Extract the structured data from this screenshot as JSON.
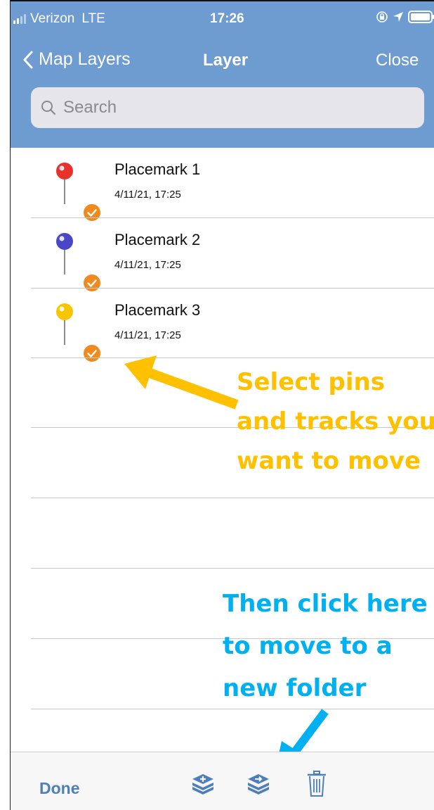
{
  "status_bar": {
    "carrier": "Verizon",
    "network": "LTE",
    "time": "17:26"
  },
  "nav": {
    "back_label": "Map Layers",
    "title": "Layer",
    "close_label": "Close"
  },
  "search": {
    "placeholder": "Search"
  },
  "placemarks": [
    {
      "title": "Placemark 1",
      "timestamp": "4/11/21, 17:25",
      "pin_color": "#e8312a",
      "selected": true
    },
    {
      "title": "Placemark 2",
      "timestamp": "4/11/21, 17:25",
      "pin_color": "#4a46c8",
      "selected": true
    },
    {
      "title": "Placemark 3",
      "timestamp": "4/11/21, 17:25",
      "pin_color": "#f7c600",
      "selected": true
    }
  ],
  "annotations": {
    "select": [
      "Select pins",
      "and tracks you",
      "want to move"
    ],
    "move": [
      "Then click here",
      "to move to a",
      "new folder"
    ],
    "select_color": "#ffc000",
    "move_color": "#00b0f0"
  },
  "toolbar": {
    "done_label": "Done",
    "icons": [
      "add-layer-icon",
      "move-to-layer-icon",
      "trash-icon"
    ],
    "accent": "#4f7fba"
  },
  "colors": {
    "header_bg": "#6e9bd0",
    "check_orange": "#ef8a1e"
  }
}
